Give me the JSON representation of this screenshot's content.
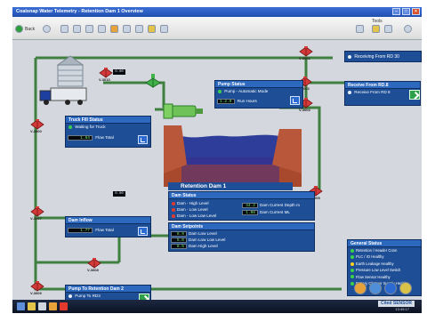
{
  "window": {
    "title": "Coalsnap Water Telemetry - Retention Dam 1 Overview",
    "controls": [
      "minimize",
      "maximize",
      "close"
    ]
  },
  "toolbar": {
    "back_label": "Back",
    "right_label": "Tools",
    "icons": [
      "back-icon",
      "forward-icon",
      "home-icon",
      "grid-icon",
      "chart-icon",
      "settings-icon",
      "alarm-icon",
      "print-icon",
      "display-icon",
      "trend-icon",
      "help-icon"
    ]
  },
  "receiving": {
    "label": "Receiving From RD 30",
    "led": "white"
  },
  "receive_panel": {
    "title": "Receive From RD.8",
    "row_label": "Receive From RD 8"
  },
  "truck_fill": {
    "title": "Truck Fill Status",
    "status_label": "Waiting for Truck",
    "readout_value": "1.64",
    "readout_label": "Flow Total"
  },
  "pump_status": {
    "title": "Pump Status",
    "mode_label": "Pump - Automatic Mode",
    "readout_value": "1.2.0",
    "readout_label": "Run Hours"
  },
  "dam_inflow": {
    "title": "Dam Inflow",
    "readout_value": "1.77",
    "readout_label": "Flow Total"
  },
  "dam_status": {
    "title": "Dam Status",
    "rows": [
      {
        "label": "Dam - High Level",
        "led": "red"
      },
      {
        "label": "Dam - Low Level",
        "led": "red"
      },
      {
        "label": "Dam - Low Low Level",
        "led": "red"
      }
    ],
    "readouts": [
      {
        "value": "44.2",
        "label": "Dam Current Depth m"
      },
      {
        "value": "1.08",
        "label": "Dam Current ML"
      }
    ]
  },
  "dam_setpoints": {
    "title": "Dam Setpoints",
    "rows": [
      {
        "value": "8.9",
        "label": "Dam Low Level"
      },
      {
        "value": "5.0",
        "label": "Dam Low Low Level"
      },
      {
        "value": "8.5",
        "label": "Dam High Level"
      }
    ]
  },
  "retention_label": "Retention Dam 1",
  "pump_to_dam": {
    "title": "Pump To Retention Dam 2",
    "row_label": "Pump To RD3"
  },
  "general_status": {
    "title": "General Status",
    "rows": [
      {
        "label": "Retention / Header Conn",
        "led": "green"
      },
      {
        "label": "PLC / IO Healthy",
        "led": "green"
      },
      {
        "label": "Earth Leakage Healthy",
        "led": "yellow"
      },
      {
        "label": "Pressure Low Level Switch",
        "led": "green"
      },
      {
        "label": "Flow Sensor Healthy",
        "led": "green"
      },
      {
        "label": "Battery Charger Supply Healthy",
        "led": "green"
      }
    ]
  },
  "valves": [
    {
      "id": "V-3001",
      "readout": "0.00"
    },
    {
      "id": "V-3000",
      "readout": ""
    },
    {
      "id": "V-3003",
      "readout": ""
    },
    {
      "id": "V-3004",
      "readout": ""
    },
    {
      "id": "V-3005",
      "readout": ""
    },
    {
      "id": "V-3007",
      "readout": "0.00"
    },
    {
      "id": "V-3008",
      "readout": ""
    },
    {
      "id": "V-3009",
      "readout": ""
    },
    {
      "id": "V-3010",
      "readout": ""
    }
  ],
  "truck_readout": "0.00",
  "taskbar": {
    "brand": "Cited SENSOR",
    "clock": "13:45:17"
  },
  "colors": {
    "pipe": "#3f7f3f",
    "panel": "#1e4f96",
    "water": "#2e3c9a",
    "earth": "#a8482c",
    "valve": "#d43a3a"
  }
}
